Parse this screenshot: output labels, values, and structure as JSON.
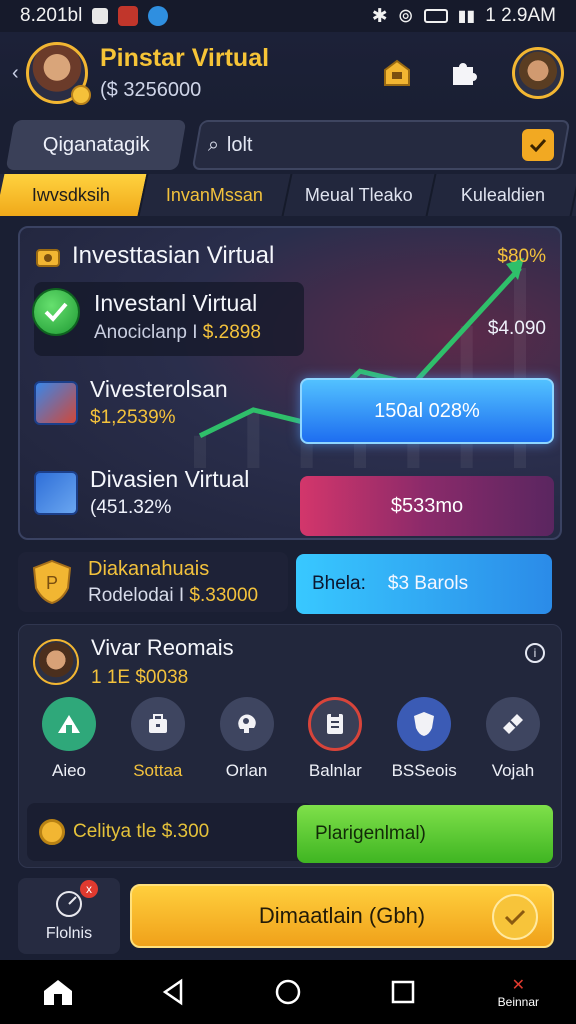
{
  "status_bar": {
    "left_text": "8.201bl",
    "time": "1 2.9AM"
  },
  "header": {
    "title": "Pinstar Virtual",
    "balance": "($ 3256000"
  },
  "search": {
    "chip_label": "Qiganatagik",
    "input_text": "lolt"
  },
  "tabs": [
    {
      "label": "Iwvsdksih"
    },
    {
      "label": "InvanMssan"
    },
    {
      "label": "Meual Tleako"
    },
    {
      "label": "Kulealdien"
    }
  ],
  "main_card": {
    "title": "Investtasian Virtual",
    "top_pct": "$80%",
    "box_title": "Investanl Virtual",
    "box_sub_label": "Anociclanp I",
    "box_sub_value": "$.2898",
    "side_value": "$4.090",
    "item1_title": "Vivesterolsan",
    "item1_value": "$1,2539%",
    "item2_title": "Divasien Virtual",
    "item2_value": "(451.32%",
    "blue_button": "150al 028%",
    "pink_button": "$533mo"
  },
  "chart_data": {
    "type": "line",
    "x": [
      0,
      1,
      2,
      3,
      4,
      5,
      6
    ],
    "y": [
      10,
      18,
      14,
      30,
      26,
      44,
      62
    ],
    "title": "",
    "xlabel": "",
    "ylabel": ""
  },
  "bonus": {
    "title": "Diakanahuais",
    "sub_label": "Rodelodai I",
    "sub_value": "$.33000",
    "btn_label": "Bhela:",
    "btn_value": "$3 Barols"
  },
  "panel": {
    "title": "Vivar Reomais",
    "sub": "1 1E $0038",
    "icons": [
      {
        "label": "Aieo",
        "icon": "home-up-icon",
        "color": "#2fa87a"
      },
      {
        "label": "Sottaa",
        "icon": "briefcase-icon",
        "color": "#3e4560"
      },
      {
        "label": "Orlan",
        "icon": "brain-icon",
        "color": "#3e4560"
      },
      {
        "label": "Balnlar",
        "icon": "clipboard-icon",
        "color": "#3a3f56"
      },
      {
        "label": "BSSeois",
        "icon": "shield-icon",
        "color": "#3b5bb5"
      },
      {
        "label": "Vojah",
        "icon": "ticket-icon",
        "color": "#3e4560"
      }
    ],
    "coin_text": "Celitya tle $.300",
    "green_btn": "Plarigenlmal)"
  },
  "footer": {
    "left_label": "Flolnis",
    "notif": "x",
    "cta": "Dimaatlain (Gbh)"
  },
  "navbar": {
    "right_label": "Beinnar"
  },
  "colors": {
    "gold": "#f3c23c",
    "bg": "#1a1f33",
    "blue": "#2b8be8",
    "green": "#3fb522",
    "pink": "#d3366b"
  }
}
